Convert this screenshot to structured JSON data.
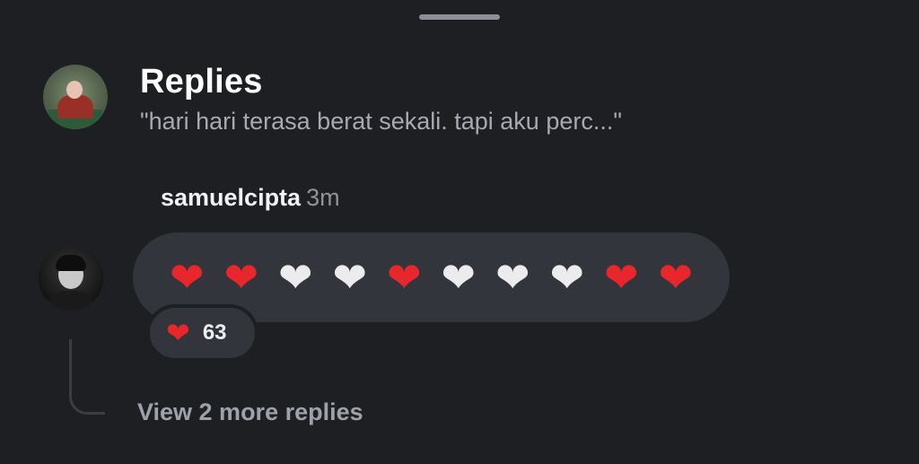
{
  "header": {
    "title": "Replies",
    "quote": "\"hari hari terasa berat sekali. tapi aku perc...\""
  },
  "reply": {
    "author": "samuelcipta",
    "time": "3m",
    "hearts": [
      {
        "icon": "red-heart",
        "glyph": "❤",
        "color": "#e8262c"
      },
      {
        "icon": "red-heart",
        "glyph": "❤",
        "color": "#e8262c"
      },
      {
        "icon": "white-heart",
        "glyph": "❤",
        "color": "#ececee"
      },
      {
        "icon": "white-heart",
        "glyph": "❤",
        "color": "#ececee"
      },
      {
        "icon": "red-heart",
        "glyph": "❤",
        "color": "#e8262c"
      },
      {
        "icon": "white-heart",
        "glyph": "❤",
        "color": "#ececee"
      },
      {
        "icon": "white-heart",
        "glyph": "❤",
        "color": "#ececee"
      },
      {
        "icon": "white-heart",
        "glyph": "❤",
        "color": "#ececee"
      },
      {
        "icon": "red-heart",
        "glyph": "❤",
        "color": "#e8262c"
      },
      {
        "icon": "red-heart",
        "glyph": "❤",
        "color": "#e8262c"
      }
    ],
    "reaction": {
      "icon": "red-heart",
      "glyph": "❤",
      "count": "63"
    }
  },
  "footer": {
    "more_replies": "View 2 more replies"
  },
  "colors": {
    "background": "#1d1f23",
    "bubble": "#32353b",
    "heart_red": "#e8262c",
    "heart_white": "#ececee"
  }
}
